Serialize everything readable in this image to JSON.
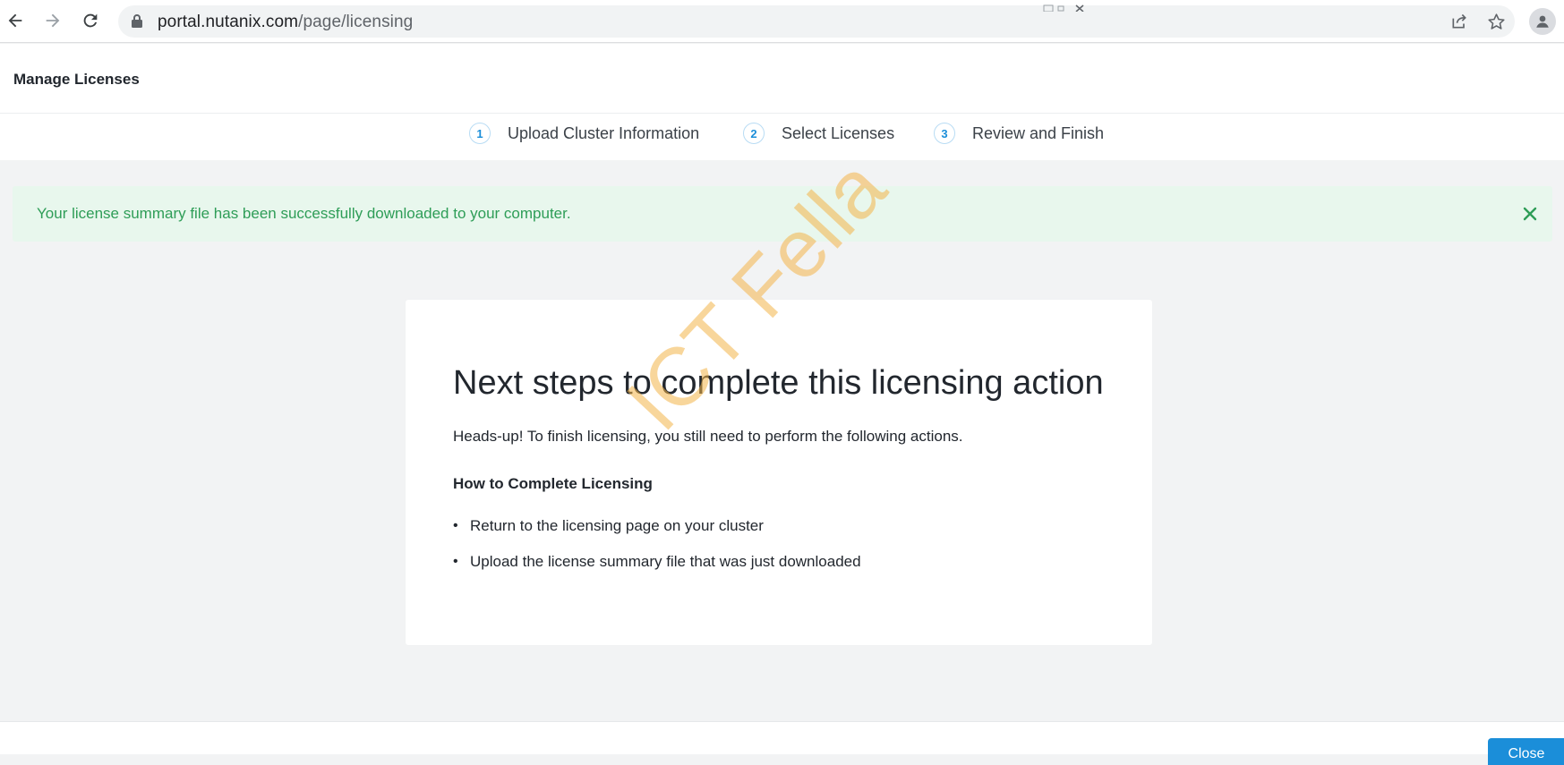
{
  "browser": {
    "url_host": "portal.nutanix.com",
    "url_path": "/page/licensing",
    "icons": [
      "back-icon",
      "forward-icon",
      "reload-icon",
      "lock-icon",
      "share-icon",
      "star-icon",
      "profile-icon"
    ]
  },
  "app": {
    "title": "Manage Licenses"
  },
  "stepper": {
    "steps": [
      {
        "number": "1",
        "label": "Upload Cluster Information"
      },
      {
        "number": "2",
        "label": "Select Licenses"
      },
      {
        "number": "3",
        "label": "Review and Finish"
      }
    ]
  },
  "alert": {
    "message": "Your license summary file has been successfully downloaded to your computer.",
    "close_icon": "close-icon",
    "color": "#2e9d57"
  },
  "card": {
    "title": "Next steps to complete this licensing action",
    "intro": "Heads-up! To finish licensing, you still need to perform the following actions.",
    "subheading": "How to Complete Licensing",
    "items": [
      "Return to the licensing page on your cluster",
      "Upload the license summary file that was just downloaded"
    ]
  },
  "watermark": "ICT Fella",
  "footer": {
    "close_label": "Close"
  },
  "colors": {
    "accent": "#1b8ed9",
    "success_bg": "#e8f7ed",
    "page_bg": "#f2f3f4"
  }
}
